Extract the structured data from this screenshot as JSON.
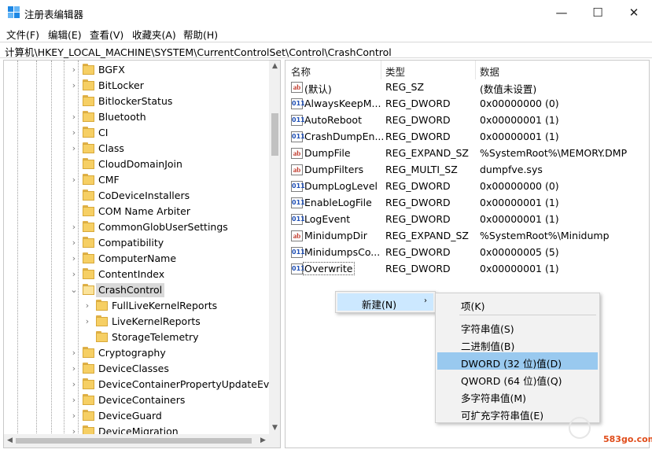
{
  "window": {
    "title": "注册表编辑器",
    "minimize": "—",
    "maximize": "☐",
    "close": "✕"
  },
  "menu": [
    "文件(F)",
    "编辑(E)",
    "查看(V)",
    "收藏夹(A)",
    "帮助(H)"
  ],
  "address": "计算机\\HKEY_LOCAL_MACHINE\\SYSTEM\\CurrentControlSet\\Control\\CrashControl",
  "tree": [
    {
      "label": "BGFX",
      "expandable": true
    },
    {
      "label": "BitLocker",
      "expandable": true
    },
    {
      "label": "BitlockerStatus",
      "expandable": false
    },
    {
      "label": "Bluetooth",
      "expandable": true
    },
    {
      "label": "CI",
      "expandable": true
    },
    {
      "label": "Class",
      "expandable": true
    },
    {
      "label": "CloudDomainJoin",
      "expandable": false
    },
    {
      "label": "CMF",
      "expandable": true
    },
    {
      "label": "CoDeviceInstallers",
      "expandable": false
    },
    {
      "label": "COM Name Arbiter",
      "expandable": false
    },
    {
      "label": "CommonGlobUserSettings",
      "expandable": true
    },
    {
      "label": "Compatibility",
      "expandable": true
    },
    {
      "label": "ComputerName",
      "expandable": true
    },
    {
      "label": "ContentIndex",
      "expandable": true
    },
    {
      "label": "CrashControl",
      "expandable": true,
      "expanded": true,
      "selected": true
    },
    {
      "label": "FullLiveKernelReports",
      "expandable": true,
      "child": true
    },
    {
      "label": "LiveKernelReports",
      "expandable": true,
      "child": true
    },
    {
      "label": "StorageTelemetry",
      "expandable": false,
      "child": true
    },
    {
      "label": "Cryptography",
      "expandable": true
    },
    {
      "label": "DeviceClasses",
      "expandable": true
    },
    {
      "label": "DeviceContainerPropertyUpdateEvents",
      "expandable": true
    },
    {
      "label": "DeviceContainers",
      "expandable": true
    },
    {
      "label": "DeviceGuard",
      "expandable": true
    },
    {
      "label": "DeviceMigration",
      "expandable": true
    }
  ],
  "list": {
    "headers": {
      "name": "名称",
      "type": "类型",
      "data": "数据"
    },
    "rows": [
      {
        "name": "(默认)",
        "type": "REG_SZ",
        "data": "(数值未设置)",
        "icon": "ab"
      },
      {
        "name": "AlwaysKeepM...",
        "type": "REG_DWORD",
        "data": "0x00000000 (0)",
        "icon": "num"
      },
      {
        "name": "AutoReboot",
        "type": "REG_DWORD",
        "data": "0x00000001 (1)",
        "icon": "num"
      },
      {
        "name": "CrashDumpEn...",
        "type": "REG_DWORD",
        "data": "0x00000001 (1)",
        "icon": "num"
      },
      {
        "name": "DumpFile",
        "type": "REG_EXPAND_SZ",
        "data": "%SystemRoot%\\MEMORY.DMP",
        "icon": "ab"
      },
      {
        "name": "DumpFilters",
        "type": "REG_MULTI_SZ",
        "data": "dumpfve.sys",
        "icon": "ab"
      },
      {
        "name": "DumpLogLevel",
        "type": "REG_DWORD",
        "data": "0x00000000 (0)",
        "icon": "num"
      },
      {
        "name": "EnableLogFile",
        "type": "REG_DWORD",
        "data": "0x00000001 (1)",
        "icon": "num"
      },
      {
        "name": "LogEvent",
        "type": "REG_DWORD",
        "data": "0x00000001 (1)",
        "icon": "num"
      },
      {
        "name": "MinidumpDir",
        "type": "REG_EXPAND_SZ",
        "data": "%SystemRoot%\\Minidump",
        "icon": "ab"
      },
      {
        "name": "MinidumpsCo...",
        "type": "REG_DWORD",
        "data": "0x00000005 (5)",
        "icon": "num"
      },
      {
        "name": "Overwrite",
        "type": "REG_DWORD",
        "data": "0x00000001 (1)",
        "icon": "num",
        "focused": true
      }
    ]
  },
  "context_menu": {
    "new_label": "新建(N)",
    "arrow": "›"
  },
  "submenu": {
    "key": "项(K)",
    "items": [
      "字符串值(S)",
      "二进制值(B)",
      "DWORD (32 位)值(D)",
      "QWORD (64 位)值(Q)",
      "多字符串值(M)",
      "可扩充字符串值(E)"
    ],
    "highlighted_index": 2
  },
  "watermark": "583go.com"
}
